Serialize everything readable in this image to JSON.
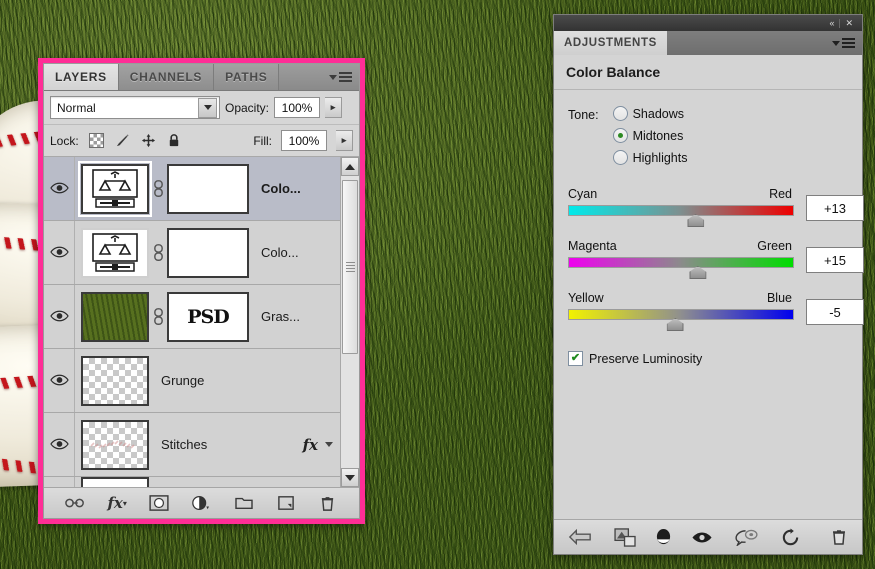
{
  "background": {
    "description": "grass-with-baseball-letter-b"
  },
  "layers_panel": {
    "accent_border_color": "#ff2d96",
    "tabs": [
      {
        "label": "LAYERS",
        "active": true
      },
      {
        "label": "CHANNELS",
        "active": false
      },
      {
        "label": "PATHS",
        "active": false
      }
    ],
    "menu_icon": "panel-menu-icon",
    "blend_mode": {
      "value": "Normal",
      "arrow_icon": "chevron-down-icon"
    },
    "opacity": {
      "label": "Opacity:",
      "value": "100%",
      "spinner_icon": "chevron-right-icon"
    },
    "lock": {
      "label": "Lock:",
      "icons": [
        "transparency-lock-icon",
        "brush-lock-icon",
        "move-lock-icon",
        "all-lock-icon"
      ]
    },
    "fill": {
      "label": "Fill:",
      "value": "100%",
      "spinner_icon": "chevron-right-icon"
    },
    "rows": [
      {
        "name": "Colo...",
        "visible": true,
        "selected": true,
        "thumb_type": "adjustment-balance",
        "linked": true,
        "has_mask": true,
        "mask_text": "",
        "fx": false
      },
      {
        "name": "Colo...",
        "visible": true,
        "selected": false,
        "thumb_type": "adjustment-balance",
        "linked": true,
        "has_mask": true,
        "mask_text": "",
        "fx": false
      },
      {
        "name": "Gras...",
        "visible": true,
        "selected": false,
        "thumb_type": "grass-image",
        "linked": true,
        "has_mask": true,
        "mask_text": "PSD",
        "fx": false
      },
      {
        "name": "Grunge",
        "visible": true,
        "selected": false,
        "thumb_type": "transparent-checker",
        "linked": false,
        "has_mask": false,
        "mask_text": "",
        "fx": false
      },
      {
        "name": "Stitches",
        "visible": true,
        "selected": false,
        "thumb_type": "transparent-checker-stitches",
        "linked": false,
        "has_mask": false,
        "mask_text": "",
        "fx": true,
        "fx_label": "fx"
      }
    ],
    "scrollbar": {
      "up_icon": "caret-up-icon",
      "down_icon": "caret-down-icon",
      "grip_icon": "scroll-grip-icon"
    },
    "footer_icons": [
      "link-layers-icon",
      "layer-style-fx-icon",
      "add-layer-mask-icon",
      "new-adjustment-layer-icon",
      "new-group-icon",
      "new-layer-icon",
      "delete-layer-icon"
    ]
  },
  "adjustments_panel": {
    "titlebar": {
      "collapse_icon": "collapse-double-arrow-icon",
      "close_icon": "close-x-icon"
    },
    "tab_label": "ADJUSTMENTS",
    "menu_icon": "panel-menu-icon",
    "heading": "Color Balance",
    "tone": {
      "label": "Tone:",
      "options": [
        {
          "label": "Shadows",
          "selected": false
        },
        {
          "label": "Midtones",
          "selected": true
        },
        {
          "label": "Highlights",
          "selected": false
        }
      ],
      "selected_color": "#2c8a22"
    },
    "sliders": [
      {
        "left_label": "Cyan",
        "right_label": "Red",
        "value": "+13",
        "position_pct": 56.5,
        "gradient_from": "#00eaea",
        "gradient_to": "#ee0000"
      },
      {
        "left_label": "Magenta",
        "right_label": "Green",
        "value": "+15",
        "position_pct": 57.5,
        "gradient_from": "#ef00ef",
        "gradient_to": "#00dd00"
      },
      {
        "left_label": "Yellow",
        "right_label": "Blue",
        "value": "-5",
        "position_pct": 47.5,
        "gradient_from": "#f2f200",
        "gradient_to": "#0000ee"
      }
    ],
    "preserve_luminosity": {
      "label": "Preserve Luminosity",
      "checked": true,
      "check_glyph": "✔"
    },
    "footer_icons": [
      "return-to-adjustment-list-icon",
      "clip-to-layer-icon",
      "toggle-layer-visibility-mask-icon",
      "preview-eye-icon",
      "view-previous-state-icon",
      "reset-adjustment-icon",
      "delete-adjustment-icon"
    ]
  }
}
